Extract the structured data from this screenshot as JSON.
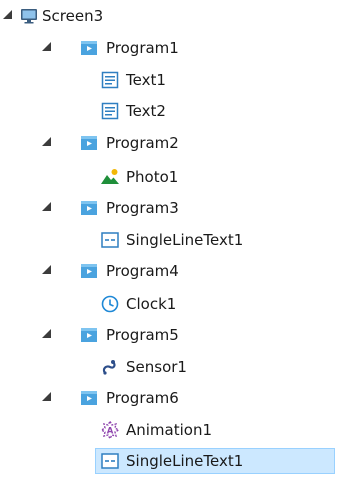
{
  "tree": [
    {
      "id": "screen3",
      "label": "Screen3",
      "icon": "screen-icon",
      "depth": 0,
      "expanded": true
    },
    {
      "id": "program1",
      "label": "Program1",
      "icon": "program-icon",
      "depth": 1,
      "expanded": true
    },
    {
      "id": "text1",
      "label": "Text1",
      "icon": "text-icon",
      "depth": 2
    },
    {
      "id": "text2",
      "label": "Text2",
      "icon": "text-icon",
      "depth": 2
    },
    {
      "id": "program2",
      "label": "Program2",
      "icon": "program-icon",
      "depth": 1,
      "expanded": true
    },
    {
      "id": "photo1",
      "label": "Photo1",
      "icon": "photo-icon",
      "depth": 2
    },
    {
      "id": "program3",
      "label": "Program3",
      "icon": "program-icon",
      "depth": 1,
      "expanded": true
    },
    {
      "id": "singlelinetext1-a",
      "label": "SingleLineText1",
      "icon": "single-line-text-icon",
      "depth": 2
    },
    {
      "id": "program4",
      "label": "Program4",
      "icon": "program-icon",
      "depth": 1,
      "expanded": true
    },
    {
      "id": "clock1",
      "label": "Clock1",
      "icon": "clock-icon",
      "depth": 2
    },
    {
      "id": "program5",
      "label": "Program5",
      "icon": "program-icon",
      "depth": 1,
      "expanded": true
    },
    {
      "id": "sensor1",
      "label": "Sensor1",
      "icon": "sensor-icon",
      "depth": 2
    },
    {
      "id": "program6",
      "label": "Program6",
      "icon": "program-icon",
      "depth": 1,
      "expanded": true
    },
    {
      "id": "animation1",
      "label": "Animation1",
      "icon": "animation-icon",
      "depth": 2
    },
    {
      "id": "singlelinetext1-b",
      "label": "SingleLineText1",
      "icon": "single-line-text-icon",
      "depth": 2,
      "selected": true
    }
  ],
  "colors": {
    "selection_bg": "#cce8ff",
    "selection_border": "#99d1ff",
    "program_icon": "#4aa3df",
    "text_icon": "#2f7fc1",
    "clock_icon": "#1e88d6",
    "photo_icon_green": "#1f8f3a",
    "photo_icon_sun": "#f2b705",
    "animation_icon": "#8e44ad",
    "sensor_icon": "#2d4e8a"
  }
}
